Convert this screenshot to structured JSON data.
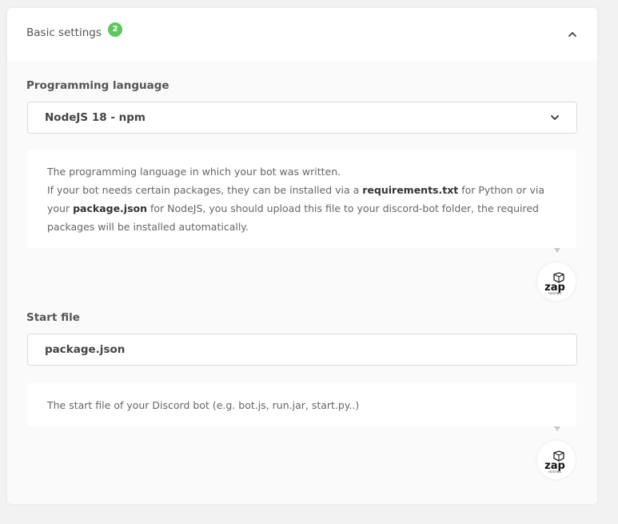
{
  "header": {
    "title": "Basic settings",
    "badge_count": "2"
  },
  "language": {
    "label": "Programming language",
    "selected": "NodeJS 18 - npm",
    "help": {
      "line1": "The programming language in which your bot was written.",
      "line2_pre": "If your bot needs certain packages, they can be installed via a ",
      "file1": "requirements.txt",
      "line2_mid": " for Python or via your ",
      "file2": "package.json",
      "line2_post": " for NodeJS, you should upload this file to your discord-bot folder, the required packages will be installed automatically."
    }
  },
  "start_file": {
    "label": "Start file",
    "value": "package.json",
    "help": "The start file of your Discord bot (e.g. bot.js, run.jar, start.py..)"
  },
  "logo": {
    "text": "zap",
    "subtext": "HOSTING"
  },
  "colors": {
    "badge": "#5cc85c",
    "card_bg": "#fafafa",
    "page_bg": "#f2f2f2"
  }
}
